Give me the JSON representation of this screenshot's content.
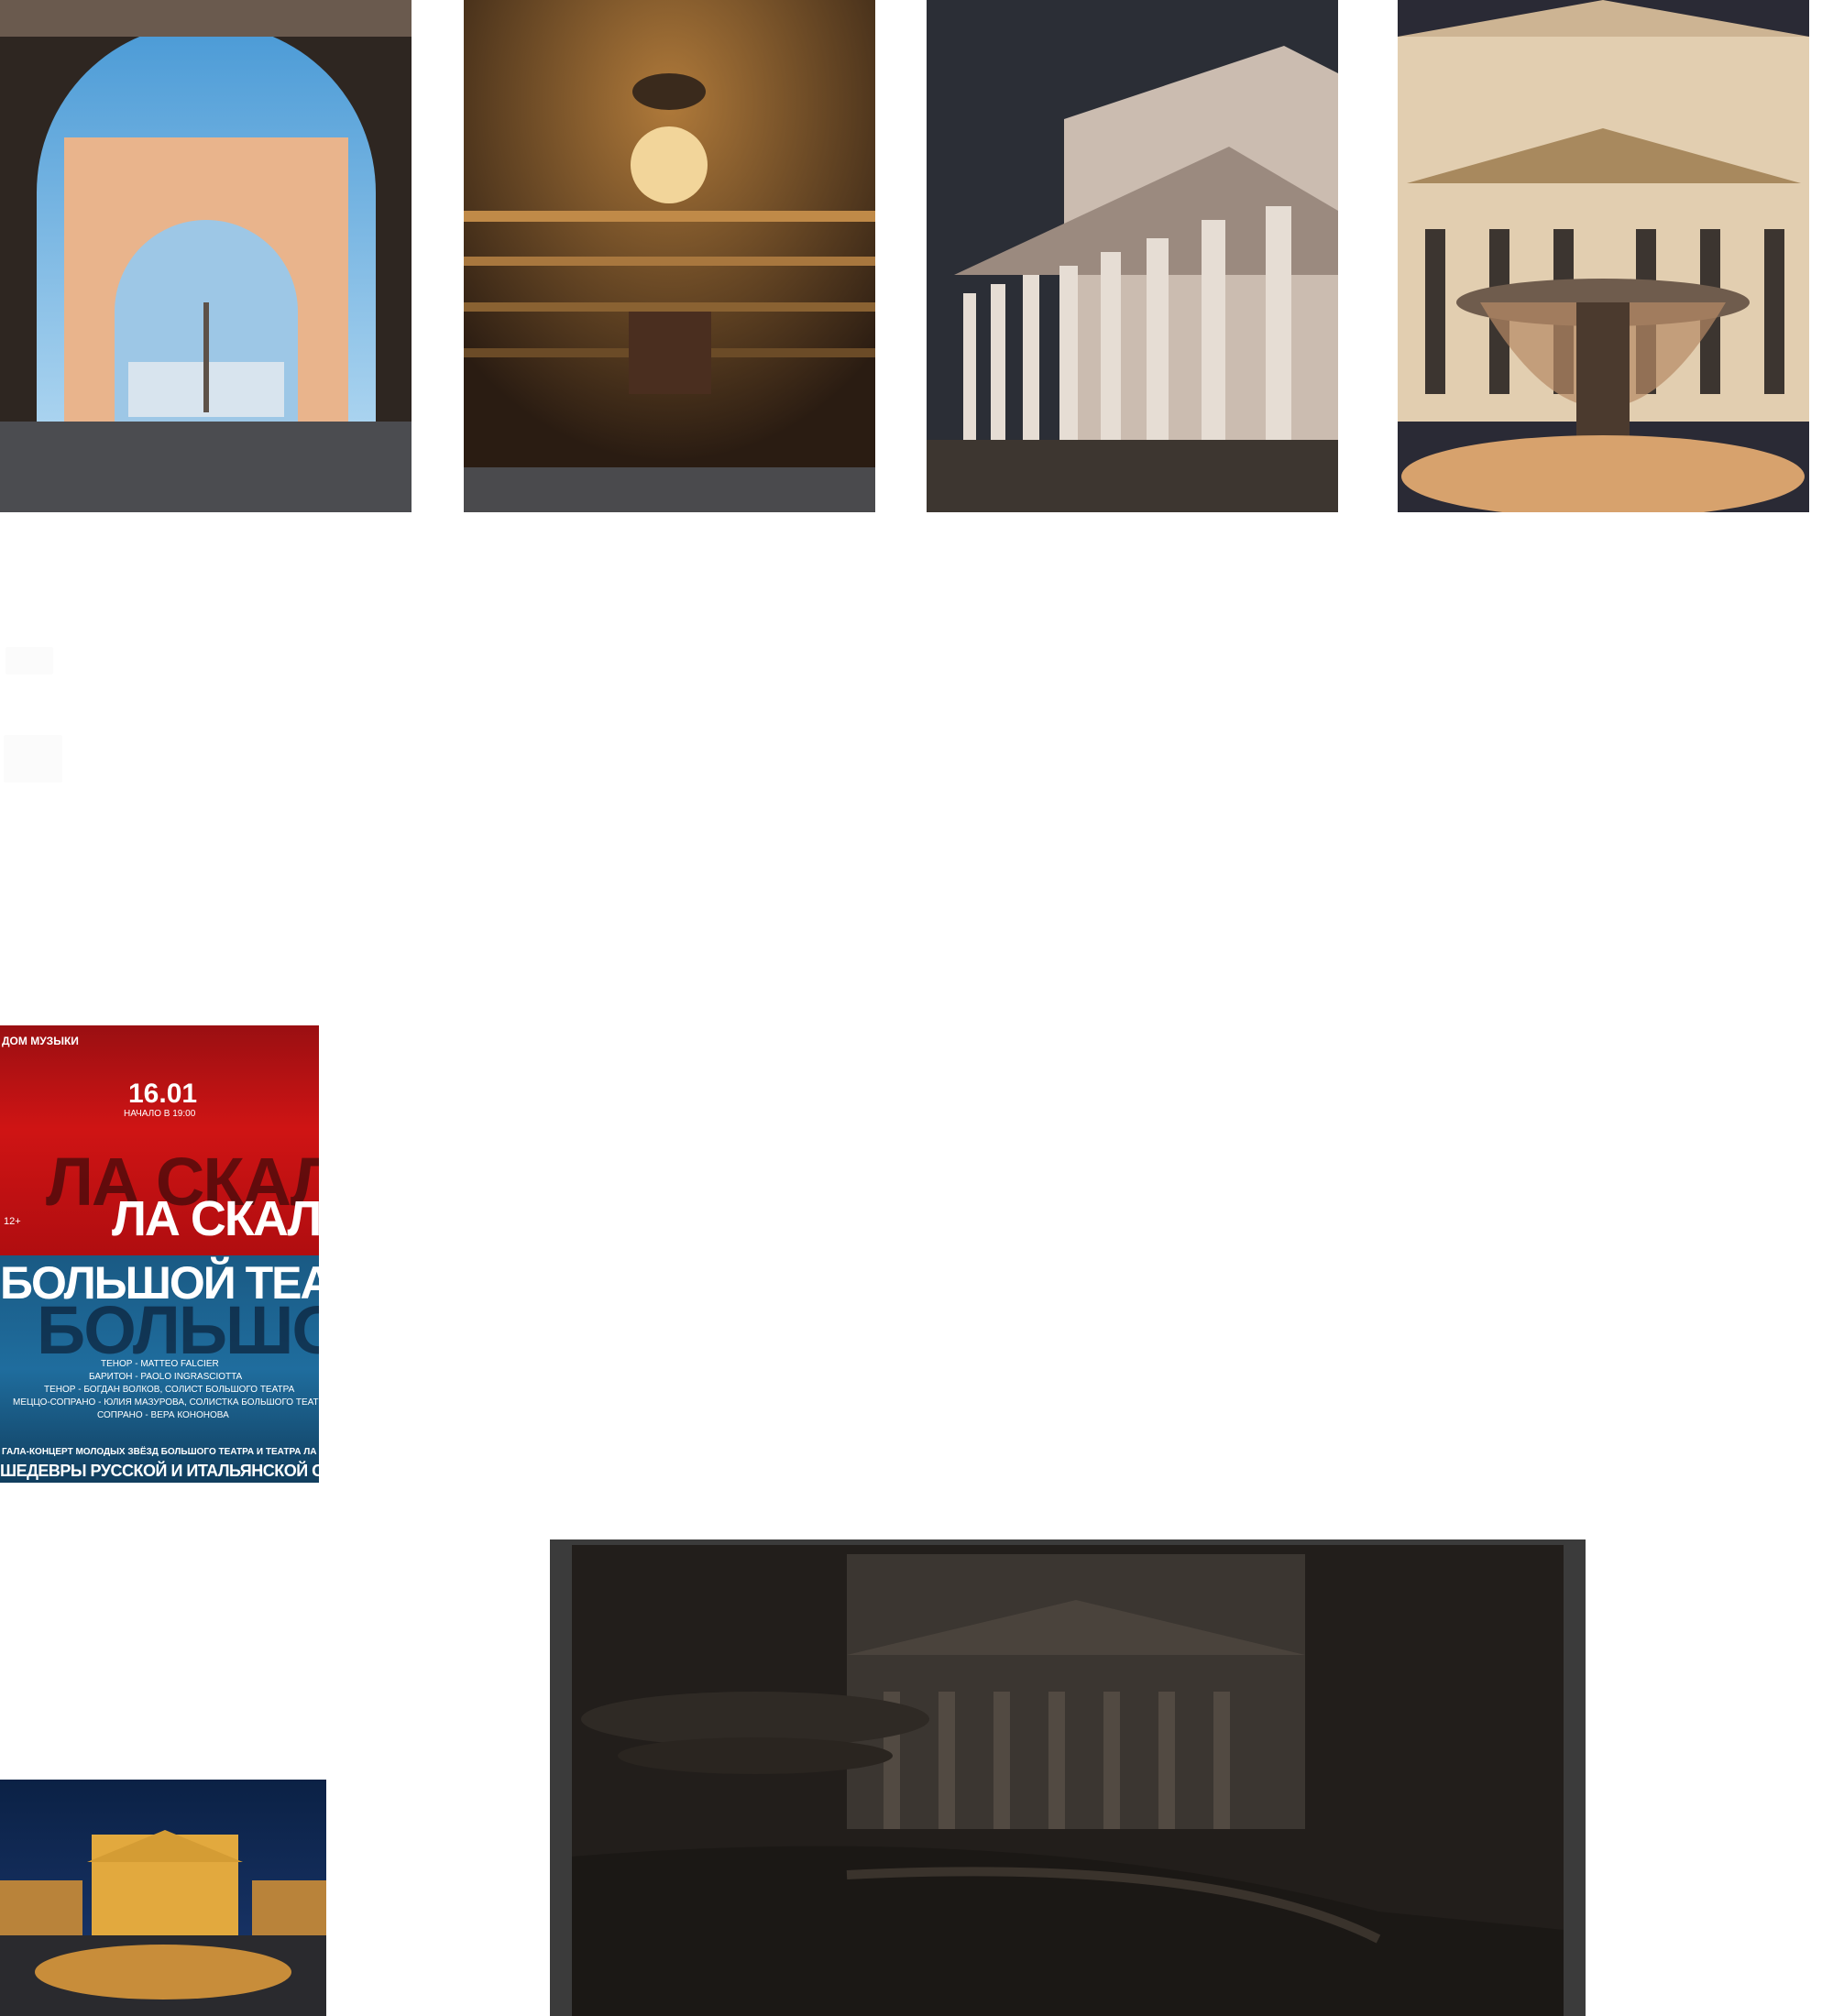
{
  "gallery": {
    "photos": [
      {
        "name": "arch-photo",
        "subject": "Arch of the General Staff Building"
      },
      {
        "name": "auditorium-photo",
        "subject": "Theatre auditorium with chandelier"
      },
      {
        "name": "facade-photo",
        "subject": "Bolshoi Theatre facade at night"
      },
      {
        "name": "fountain-photo",
        "subject": "Bolshoi Theatre with fountain"
      }
    ]
  },
  "poster": {
    "brand": "ДОМ МУЗЫКИ",
    "date": "16.01",
    "start_time": "НАЧАЛО В 19:00",
    "age": "12+",
    "shadow_top": "ЛА СКАЛА",
    "title_1": "ЛА СКАЛА",
    "title_2": "БОЛЬШОЙ ТЕАТР",
    "shadow_bottom": "БОЛЬШОЙ",
    "cast": [
      "ТЕНОР -   MATTEO FALCIER",
      "БАРИТОН - PAOLO INGRASCIOTTA",
      "ТЕНОР - БОГДАН ВОЛКОВ, СОЛИСТ БОЛЬШОГО ТЕАТРА",
      "МЕЦЦО-СОПРАНО - ЮЛИЯ МАЗУРОВА, СОЛИСТКА БОЛЬШОГО ТЕАТРА",
      "СОПРАНО - ВЕРА КОНОНОВА"
    ],
    "subtitle": "ГАЛА-КОНЦЕРТ МОЛОДЫХ ЗВЁЗД БОЛЬШОГО ТЕАТРА И ТЕАТРА ЛА СКАЛА:",
    "headline": "ШЕДЕВРЫ РУССКОЙ И ИТАЛЬЯНСКОЙ ОПЕРЫ"
  },
  "colors": {
    "poster_red": "#cf1414",
    "poster_blue": "#1f6d9e",
    "modal_frame": "#3b3b3b"
  }
}
